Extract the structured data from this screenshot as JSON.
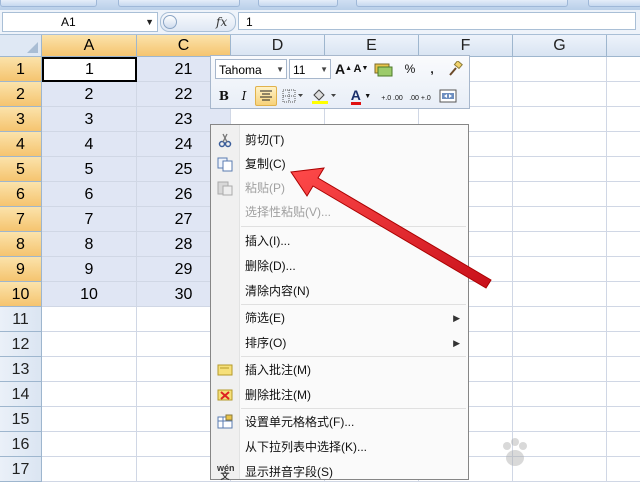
{
  "name_box": {
    "value": "A1"
  },
  "formula": {
    "fx": "fx",
    "value": "1"
  },
  "columns": [
    {
      "label": "A",
      "selected": true
    },
    {
      "label": "C",
      "selected": true
    },
    {
      "label": "D",
      "selected": false
    },
    {
      "label": "E",
      "selected": false
    },
    {
      "label": "F",
      "selected": false
    },
    {
      "label": "G",
      "selected": false
    }
  ],
  "rows": [
    {
      "num": "1",
      "a": "1",
      "c": "21"
    },
    {
      "num": "2",
      "a": "2",
      "c": "22"
    },
    {
      "num": "3",
      "a": "3",
      "c": "23"
    },
    {
      "num": "4",
      "a": "4",
      "c": "24"
    },
    {
      "num": "5",
      "a": "5",
      "c": "25"
    },
    {
      "num": "6",
      "a": "6",
      "c": "26"
    },
    {
      "num": "7",
      "a": "7",
      "c": "27"
    },
    {
      "num": "8",
      "a": "8",
      "c": "28"
    },
    {
      "num": "9",
      "a": "9",
      "c": "29"
    },
    {
      "num": "10",
      "a": "10",
      "c": "30"
    },
    {
      "num": "11",
      "a": "",
      "c": ""
    },
    {
      "num": "12",
      "a": "",
      "c": ""
    },
    {
      "num": "13",
      "a": "",
      "c": ""
    },
    {
      "num": "14",
      "a": "",
      "c": ""
    },
    {
      "num": "15",
      "a": "",
      "c": ""
    },
    {
      "num": "16",
      "a": "",
      "c": ""
    },
    {
      "num": "17",
      "a": "",
      "c": ""
    }
  ],
  "mini_toolbar": {
    "font": "Tahoma",
    "size": "11",
    "grow": "A",
    "shrink": "A",
    "percent": "%",
    "comma": ",",
    "bold": "B",
    "italic": "I",
    "font_color": "A",
    "inc_decimal": "+.0 .00",
    "dec_decimal": ".00 +.0",
    "font_color_value": "#e01010",
    "fill_color_value": "#ffff00"
  },
  "context_menu": {
    "items": [
      {
        "label": "剪切(T)",
        "icon": "scissors-icon",
        "disabled": false,
        "submenu": false
      },
      {
        "label": "复制(C)",
        "icon": "copy-icon",
        "disabled": false,
        "submenu": false
      },
      {
        "label": "粘贴(P)",
        "icon": "paste-icon",
        "disabled": true,
        "submenu": false
      },
      {
        "label": "选择性粘贴(V)...",
        "icon": "",
        "disabled": true,
        "submenu": false
      },
      {
        "label": "插入(I)...",
        "icon": "",
        "disabled": false,
        "submenu": false
      },
      {
        "label": "删除(D)...",
        "icon": "",
        "disabled": false,
        "submenu": false
      },
      {
        "label": "清除内容(N)",
        "icon": "",
        "disabled": false,
        "submenu": false
      },
      {
        "label": "筛选(E)",
        "icon": "",
        "disabled": false,
        "submenu": true
      },
      {
        "label": "排序(O)",
        "icon": "",
        "disabled": false,
        "submenu": true
      },
      {
        "label": "插入批注(M)",
        "icon": "insert-comment-icon",
        "disabled": false,
        "submenu": false
      },
      {
        "label": "删除批注(M)",
        "icon": "delete-comment-icon",
        "disabled": false,
        "submenu": false
      },
      {
        "label": "设置单元格格式(F)...",
        "icon": "format-cells-icon",
        "disabled": false,
        "submenu": false
      },
      {
        "label": "从下拉列表中选择(K)...",
        "icon": "",
        "disabled": false,
        "submenu": false
      },
      {
        "label": "显示拼音字段(S)",
        "icon": "phonetic-icon",
        "disabled": false,
        "submenu": false
      }
    ]
  },
  "annotation": {
    "arrow_color": "#e8202a"
  },
  "colors": {
    "selection": "#e0e6f4",
    "header_selected": "#f5c46f"
  }
}
